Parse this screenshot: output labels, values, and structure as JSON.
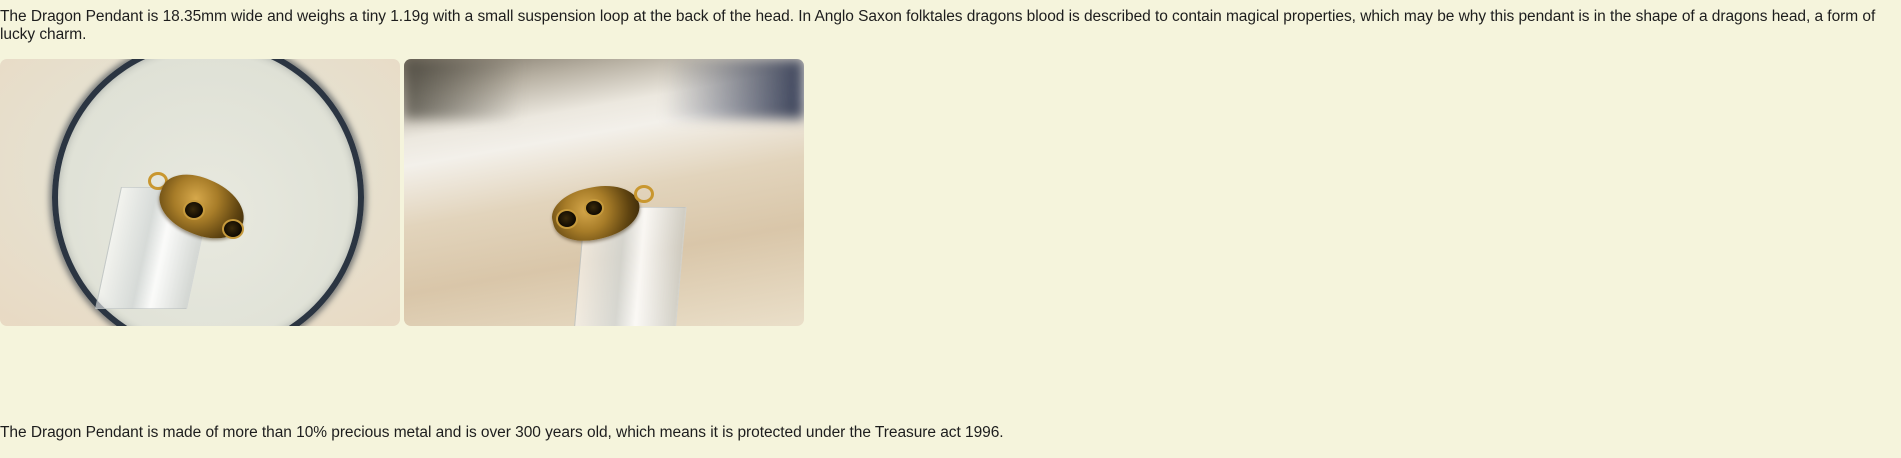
{
  "article": {
    "paragraph_1": "The Dragon Pendant is 18.35mm wide and weighs a tiny 1.19g with a small suspension loop at the back of the head. In Anglo Saxon folktales dragons blood is described to contain magical properties, which may be why this pendant is in the shape of a dragons head, a form of lucky charm.",
    "paragraph_2": "The Dragon Pendant is made of more than 10% precious metal and is over 300 years old, which means it is protected under the Treasure act 1996."
  },
  "colors": {
    "page_background": "#f5f4dc",
    "text": "#1d1d1d",
    "gold": "#c9972f"
  }
}
